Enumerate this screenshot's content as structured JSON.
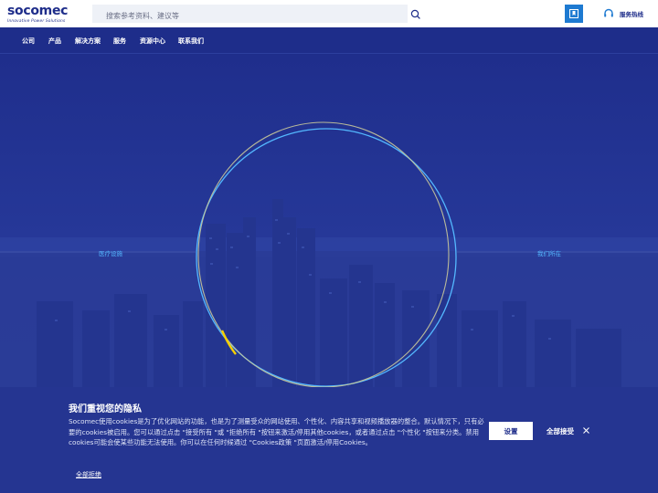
{
  "brand": {
    "name": "socomec",
    "tagline": "Innovative Power Solutions",
    "color": "#1e2d8a",
    "accent": "#f6d000"
  },
  "header": {
    "search": {
      "placeholder": "搜索参考资料、建议等",
      "value": ""
    },
    "search_icon": "search-icon",
    "bookmark_icon": "bookmark-icon",
    "hotline": {
      "icon": "headset-icon",
      "label": "服务热线"
    }
  },
  "nav": {
    "items": [
      {
        "label": "公司"
      },
      {
        "label": "产品"
      },
      {
        "label": "解决方案"
      },
      {
        "label": "服务"
      },
      {
        "label": "资源中心"
      },
      {
        "label": "联系我们"
      }
    ]
  },
  "hero": {
    "left_label": "医疗设施",
    "right_label": "我们所在"
  },
  "cookie_banner": {
    "title": "我们重视您的隐私",
    "text": "Socomec使用cookies是为了优化网站的功能，也是为了测量受众的网站使用、个性化、内容共享和视频播放器的整合。默认情况下，只有必要的cookies被启用。您可以通过点击 \"接受所有 \"或 \"拒绝所有 \"按钮来激活/停用其他cookies，或者通过点击 \"个性化 \"按钮来分类。禁用cookies可能会使某些功能无法使用。你可以在任何时候通过 \"Cookies政策 \"页面激活/停用Cookies。",
    "settings_button": "设置",
    "accept_all": "全部接受",
    "reject_all": "全部拒绝",
    "close_icon": "close-icon"
  },
  "colors": {
    "header_bg": "#ffffff",
    "nav_bg": "#1e2d8a",
    "hero_bg": "#223392",
    "link_blue": "#54b8ff",
    "button_blue": "#1e7ad1",
    "banner_bg": "#253591"
  }
}
